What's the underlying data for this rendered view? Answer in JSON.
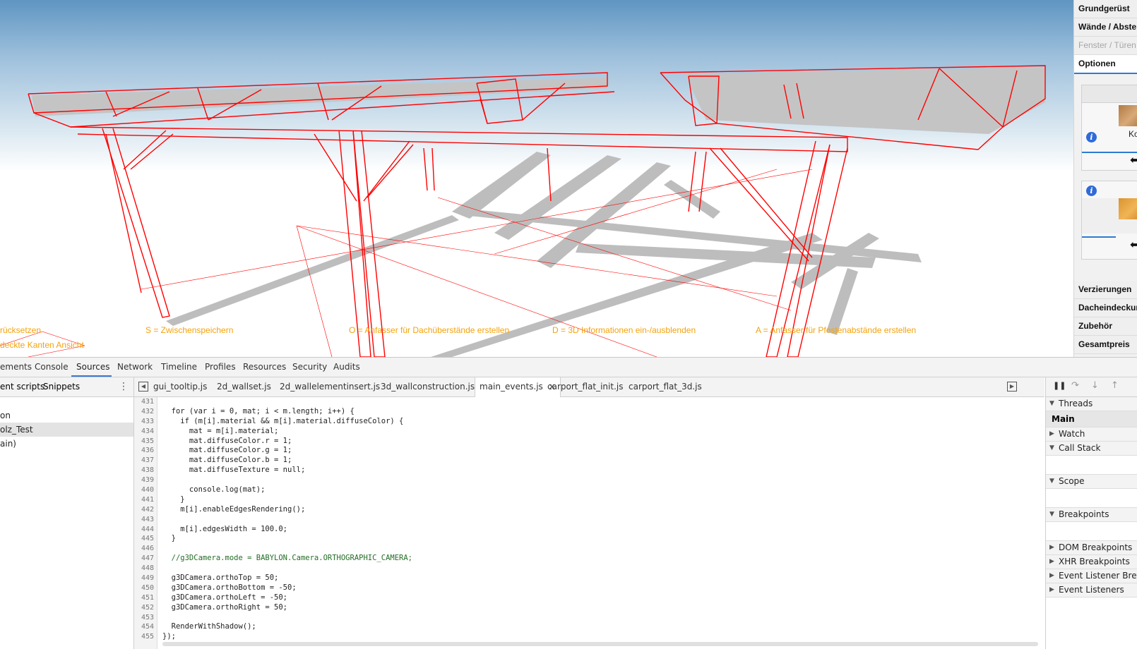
{
  "scene": {
    "hints": [
      "rücksetzen",
      "S = Zwischenspeichern",
      "O = Anfasser für Dachüberstände erstellen",
      "D = 3D Informationen ein-/ausblenden",
      "A = Anfasser für Pfostenabstände erstellen",
      "deckte Kanten Ansicht"
    ],
    "colors": {
      "edge": "#ff0000",
      "shadow": "#bdbdbd",
      "hint": "#f5a20a"
    }
  },
  "right_panel": {
    "menu": [
      "Grundgerüst",
      "Wände / Abstel",
      "Fenster / Türen",
      "Optionen"
    ],
    "option_label": "Ko",
    "bottom_menu": [
      "Verzierungen",
      "Dacheindeckun",
      "Zubehör",
      "Gesamtpreis"
    ],
    "info_icon": "i"
  },
  "devtools": {
    "main_tabs": [
      "ements",
      "Console",
      "Sources",
      "Network",
      "Timeline",
      "Profiles",
      "Resources",
      "Security",
      "Audits"
    ],
    "active_tab": "Sources",
    "left_tabs": [
      "ent scripts",
      "Snippets"
    ],
    "tree": [
      "on",
      "olz_Test",
      "ain)"
    ],
    "file_tabs": [
      "gui_tooltip.js",
      "2d_wallset.js",
      "2d_wallelementinsert.js",
      "3d_wallconstruction.js",
      "main_events.js",
      "carport_flat_init.js",
      "carport_flat_3d.js"
    ],
    "active_file": "main_events.js",
    "close_glyph": "×",
    "line_numbers": [
      "431",
      "432",
      "433",
      "434",
      "435",
      "436",
      "437",
      "438",
      "439",
      "440",
      "441",
      "442",
      "443",
      "444",
      "445",
      "446",
      "447",
      "448",
      "449",
      "450",
      "451",
      "452",
      "453",
      "454",
      "455"
    ],
    "code_lines": [
      "",
      "  for (var i = 0, mat; i < m.length; i++) {",
      "    if (m[i].material && m[i].material.diffuseColor) {",
      "      mat = m[i].material;",
      "      mat.diffuseColor.r = 1;",
      "      mat.diffuseColor.g = 1;",
      "      mat.diffuseColor.b = 1;",
      "      mat.diffuseTexture = null;",
      "",
      "      console.log(mat);",
      "    }",
      "    m[i].enableEdgesRendering();",
      "",
      "    m[i].edgesWidth = 100.0;",
      "  }",
      "",
      "  //g3DCamera.mode = BABYLON.Camera.ORTHOGRAPHIC_CAMERA;",
      "",
      "  g3DCamera.orthoTop = 50;",
      "  g3DCamera.orthoBottom = -50;",
      "  g3DCamera.orthoLeft = -50;",
      "  g3DCamera.orthoRight = 50;",
      "",
      "  RenderWithShadow();",
      "});"
    ],
    "debugger": {
      "sections": [
        "Threads",
        "Main",
        "Watch",
        "Call Stack",
        "Scope",
        "Breakpoints",
        "DOM Breakpoints",
        "XHR Breakpoints",
        "Event Listener Breakp",
        "Event Listeners"
      ]
    }
  }
}
